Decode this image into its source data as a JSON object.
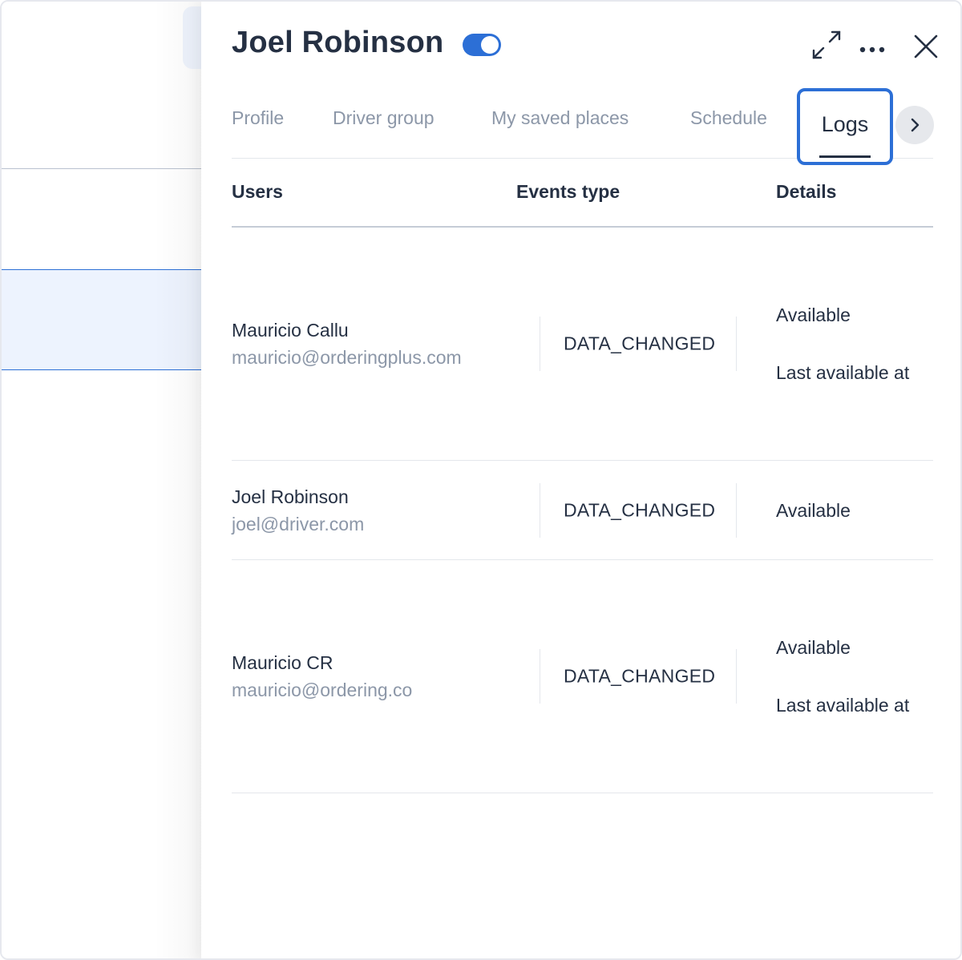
{
  "drawer": {
    "title": "Joel Robinson",
    "toggle_on": true,
    "accent_color": "#2c6fd6",
    "header_icons": [
      "expand-icon",
      "more-icon",
      "close-icon"
    ]
  },
  "tabs": [
    {
      "label": "Profile"
    },
    {
      "label": "Driver group"
    },
    {
      "label": "My saved places"
    },
    {
      "label": "Schedule"
    },
    {
      "label": "Logs",
      "active": true
    }
  ],
  "table": {
    "headers": {
      "users": "Users",
      "events": "Events type",
      "details": "Details"
    },
    "rows": [
      {
        "name": "Mauricio Callu",
        "email": "mauricio@orderingplus.com",
        "event": "DATA_CHANGED",
        "details": [
          "Available",
          "Last available at"
        ]
      },
      {
        "name": "Joel Robinson",
        "email": "joel@driver.com",
        "event": "DATA_CHANGED",
        "details": [
          "Available"
        ]
      },
      {
        "name": "Mauricio CR",
        "email": "mauricio@ordering.co",
        "event": "DATA_CHANGED",
        "details": [
          "Available",
          "Last available at"
        ]
      }
    ]
  }
}
